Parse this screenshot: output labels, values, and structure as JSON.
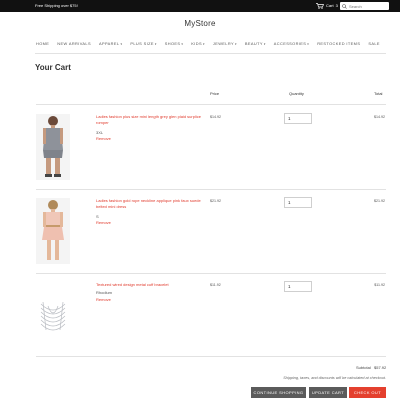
{
  "topbar": {
    "promo": "Free Shipping over $75!",
    "cart_label": "Cart",
    "cart_count": "3",
    "search_placeholder": "Search"
  },
  "store": {
    "name": "MyStore"
  },
  "nav": {
    "items": [
      {
        "label": "Home",
        "has_dropdown": false
      },
      {
        "label": "New Arrivals",
        "has_dropdown": false
      },
      {
        "label": "Apparel",
        "has_dropdown": true
      },
      {
        "label": "Plus Size",
        "has_dropdown": true
      },
      {
        "label": "Shoes",
        "has_dropdown": true
      },
      {
        "label": "Kids",
        "has_dropdown": true
      },
      {
        "label": "Jewelry",
        "has_dropdown": true
      },
      {
        "label": "Beauty",
        "has_dropdown": true
      },
      {
        "label": "Accessories",
        "has_dropdown": true
      },
      {
        "label": "Restocked Items",
        "has_dropdown": false
      },
      {
        "label": "Sale",
        "has_dropdown": false
      }
    ]
  },
  "cart": {
    "title": "Your Cart",
    "columns": {
      "price": "Price",
      "quantity": "Quantity",
      "total": "Total"
    },
    "items": [
      {
        "name": "Ladies fashion plus size mini length grey glen plaid surplice romper",
        "variant": "3XL",
        "remove": "Remove",
        "price": "$14.92",
        "quantity": "1",
        "total": "$14.92"
      },
      {
        "name": "Ladies fashion gold rope neckline applique pink faux suede belted mini dress",
        "variant": "S",
        "remove": "Remove",
        "price": "$21.92",
        "quantity": "1",
        "total": "$21.92"
      },
      {
        "name": "Textured wired design metal cuff bracelet",
        "variant": "Rhodium",
        "remove": "Remove",
        "price": "$11.92",
        "quantity": "1",
        "total": "$11.92"
      }
    ],
    "subtotal_label": "Subtotal",
    "subtotal_value": "$57.92",
    "note": "Shipping, taxes, and discounts will be calculated at checkout.",
    "buttons": {
      "continue": "Continue Shopping",
      "update": "Update Cart",
      "checkout": "Check Out"
    }
  }
}
